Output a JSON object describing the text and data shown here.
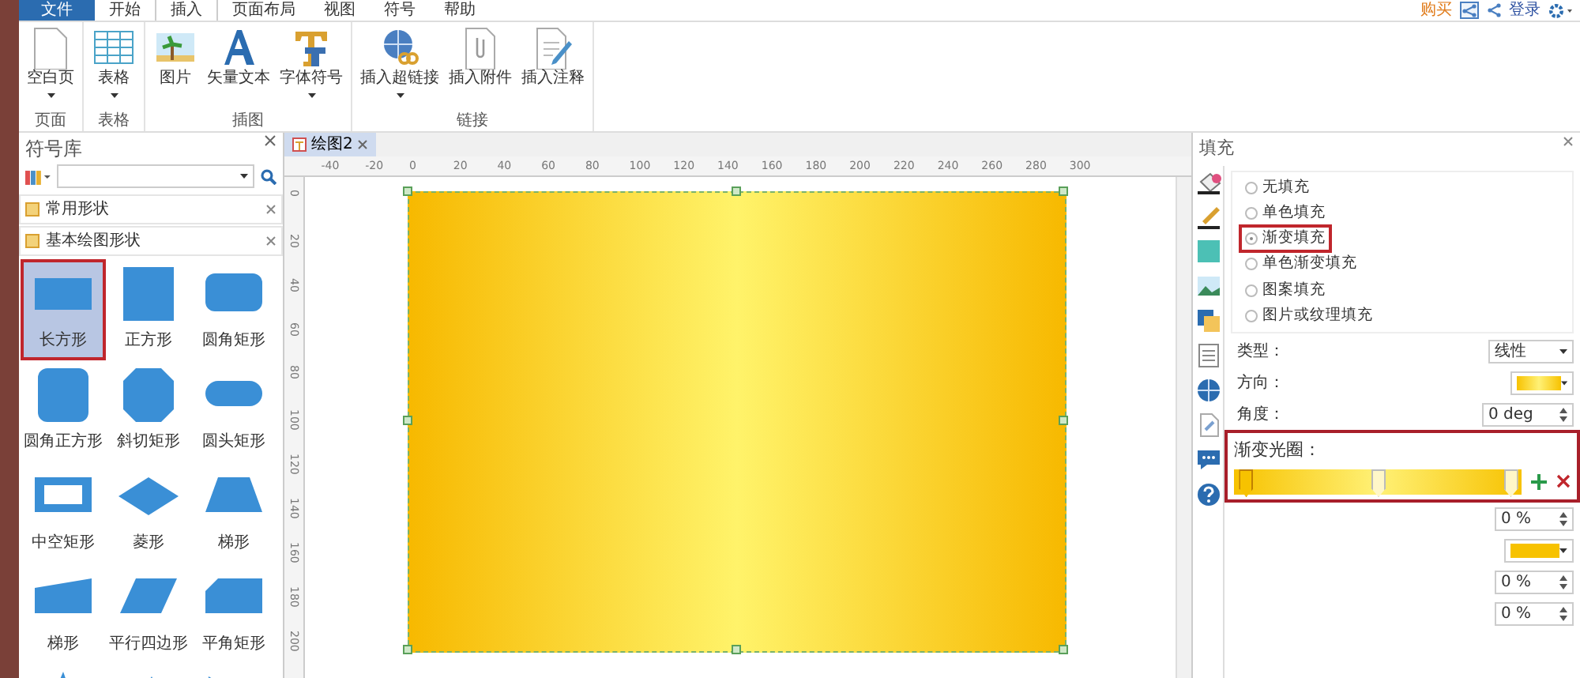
{
  "menu_tabs": [
    {
      "label": "文件",
      "kind": "file",
      "selected": false
    },
    {
      "label": "开始",
      "kind": "tab",
      "selected": false
    },
    {
      "label": "插入",
      "kind": "tab",
      "selected": true
    },
    {
      "label": "页面布局",
      "kind": "tab",
      "selected": false
    },
    {
      "label": "视图",
      "kind": "tab",
      "selected": false
    },
    {
      "label": "符号",
      "kind": "tab",
      "selected": false
    },
    {
      "label": "帮助",
      "kind": "tab",
      "selected": false
    }
  ],
  "account": {
    "buy": "购买",
    "login": "登录"
  },
  "ribbon_groups": [
    {
      "label": "页面",
      "buttons": [
        {
          "label": "空白页",
          "kind": "blank-page",
          "has_menu": true
        }
      ]
    },
    {
      "label": "表格",
      "buttons": [
        {
          "label": "表格",
          "kind": "table",
          "has_menu": true
        }
      ]
    },
    {
      "label": "插图",
      "buttons": [
        {
          "label": "图片",
          "kind": "picture",
          "has_menu": false
        },
        {
          "label": "矢量文本",
          "kind": "vector-text",
          "has_menu": false
        },
        {
          "label": "字体符号",
          "kind": "font-symbol",
          "has_menu": true
        }
      ]
    },
    {
      "label": "链接",
      "buttons": [
        {
          "label": "插入超链接",
          "kind": "hyperlink",
          "has_menu": true
        },
        {
          "label": "插入附件",
          "kind": "attachment",
          "has_menu": false
        },
        {
          "label": "插入注释",
          "kind": "note",
          "has_menu": false
        }
      ]
    }
  ],
  "symbol_library": {
    "title": "符号库",
    "categories": [
      {
        "label": "常用形状"
      },
      {
        "label": "基本绘图形状"
      }
    ],
    "shapes": [
      {
        "label": "长方形",
        "kind": "rect",
        "selected": true
      },
      {
        "label": "正方形",
        "kind": "square",
        "selected": false
      },
      {
        "label": "圆角矩形",
        "kind": "rounded-rect",
        "selected": false
      },
      {
        "label": "圆角正方形",
        "kind": "rounded-square",
        "selected": false
      },
      {
        "label": "斜切矩形",
        "kind": "octagon",
        "selected": false
      },
      {
        "label": "圆头矩形",
        "kind": "stadium",
        "selected": false
      },
      {
        "label": "中空矩形",
        "kind": "hollow-rect",
        "selected": false
      },
      {
        "label": "菱形",
        "kind": "diamond",
        "selected": false
      },
      {
        "label": "梯形",
        "kind": "trapezoid",
        "selected": false
      },
      {
        "label": "梯形",
        "kind": "slant-quad",
        "selected": false
      },
      {
        "label": "平行四边形",
        "kind": "parallelogram",
        "selected": false
      },
      {
        "label": "平角矩形",
        "kind": "cut-corner",
        "selected": false
      },
      {
        "kind": "triangle-right-angle",
        "selected": false
      },
      {
        "kind": "triangle",
        "selected": false
      },
      {
        "kind": "triangle-pointing",
        "selected": false
      }
    ]
  },
  "document_tab": {
    "label": "绘图2"
  },
  "ruler": {
    "x_labels": [
      "-40",
      "-20",
      "0",
      "20",
      "40",
      "60",
      "80",
      "100",
      "120",
      "140",
      "160",
      "180",
      "200",
      "220",
      "240",
      "260",
      "280",
      "300"
    ],
    "y_labels": [
      "0",
      "20",
      "40",
      "60",
      "80",
      "100",
      "120",
      "140",
      "160",
      "180",
      "200"
    ]
  },
  "fill_panel": {
    "title": "填充",
    "options": [
      {
        "label": "无填充",
        "selected": false,
        "highlighted": false
      },
      {
        "label": "单色填充",
        "selected": false,
        "highlighted": false
      },
      {
        "label": "渐变填充",
        "selected": true,
        "highlighted": true
      },
      {
        "label": "单色渐变填充",
        "selected": false,
        "highlighted": false
      },
      {
        "label": "图案填充",
        "selected": false,
        "highlighted": false
      },
      {
        "label": "图片或纹理填充",
        "selected": false,
        "highlighted": false
      }
    ],
    "type": {
      "label": "类型：",
      "value": "线性"
    },
    "direction": {
      "label": "方向："
    },
    "angle": {
      "label": "角度：",
      "value": "0 deg"
    },
    "gradient_stops": {
      "label": "渐变光圈：",
      "highlighted": true,
      "stops": [
        {
          "level": 0,
          "selected": true
        },
        {
          "level": 0.5,
          "selected": false
        },
        {
          "level": 1,
          "selected": false
        }
      ]
    },
    "stop_fields": [
      {
        "kind": "number",
        "value": "0 %"
      },
      {
        "kind": "color"
      },
      {
        "kind": "number",
        "value": "0 %"
      },
      {
        "kind": "number",
        "value": "0 %"
      }
    ]
  }
}
